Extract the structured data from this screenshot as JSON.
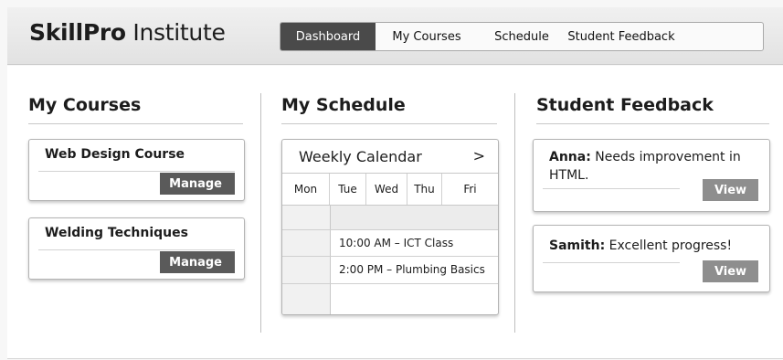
{
  "app": {
    "brand_bold": "SkillPro",
    "brand_light": " Institute"
  },
  "nav": {
    "tabs": [
      "Dashboard",
      "My Courses",
      "Schedule",
      "Student Feedback"
    ],
    "active": "Dashboard"
  },
  "courses": {
    "title": "My Courses",
    "items": [
      {
        "name": "Web Design Course",
        "action": "Manage"
      },
      {
        "name": "Welding Techniques",
        "action": "Manage"
      }
    ]
  },
  "schedule": {
    "title": "My Schedule",
    "calendar_title": "Weekly Calendar",
    "next_symbol": ">",
    "days": [
      "Mon",
      "Tue",
      "Wed",
      "Thu",
      "Fri"
    ],
    "events": [
      "10:00 AM – ICT Class",
      "2:00 PM – Plumbing Basics"
    ]
  },
  "feedback": {
    "title": "Student Feedback",
    "items": [
      {
        "author": "Anna:",
        "text": " Needs improvement in HTML.",
        "action": "View"
      },
      {
        "author": "Samith:",
        "text": " Excellent progress!",
        "action": "View"
      }
    ]
  },
  "colors": {
    "active_tab": "#4a4a4a",
    "manage_button": "#5a5a5a",
    "view_button": "#8e8e8e"
  }
}
